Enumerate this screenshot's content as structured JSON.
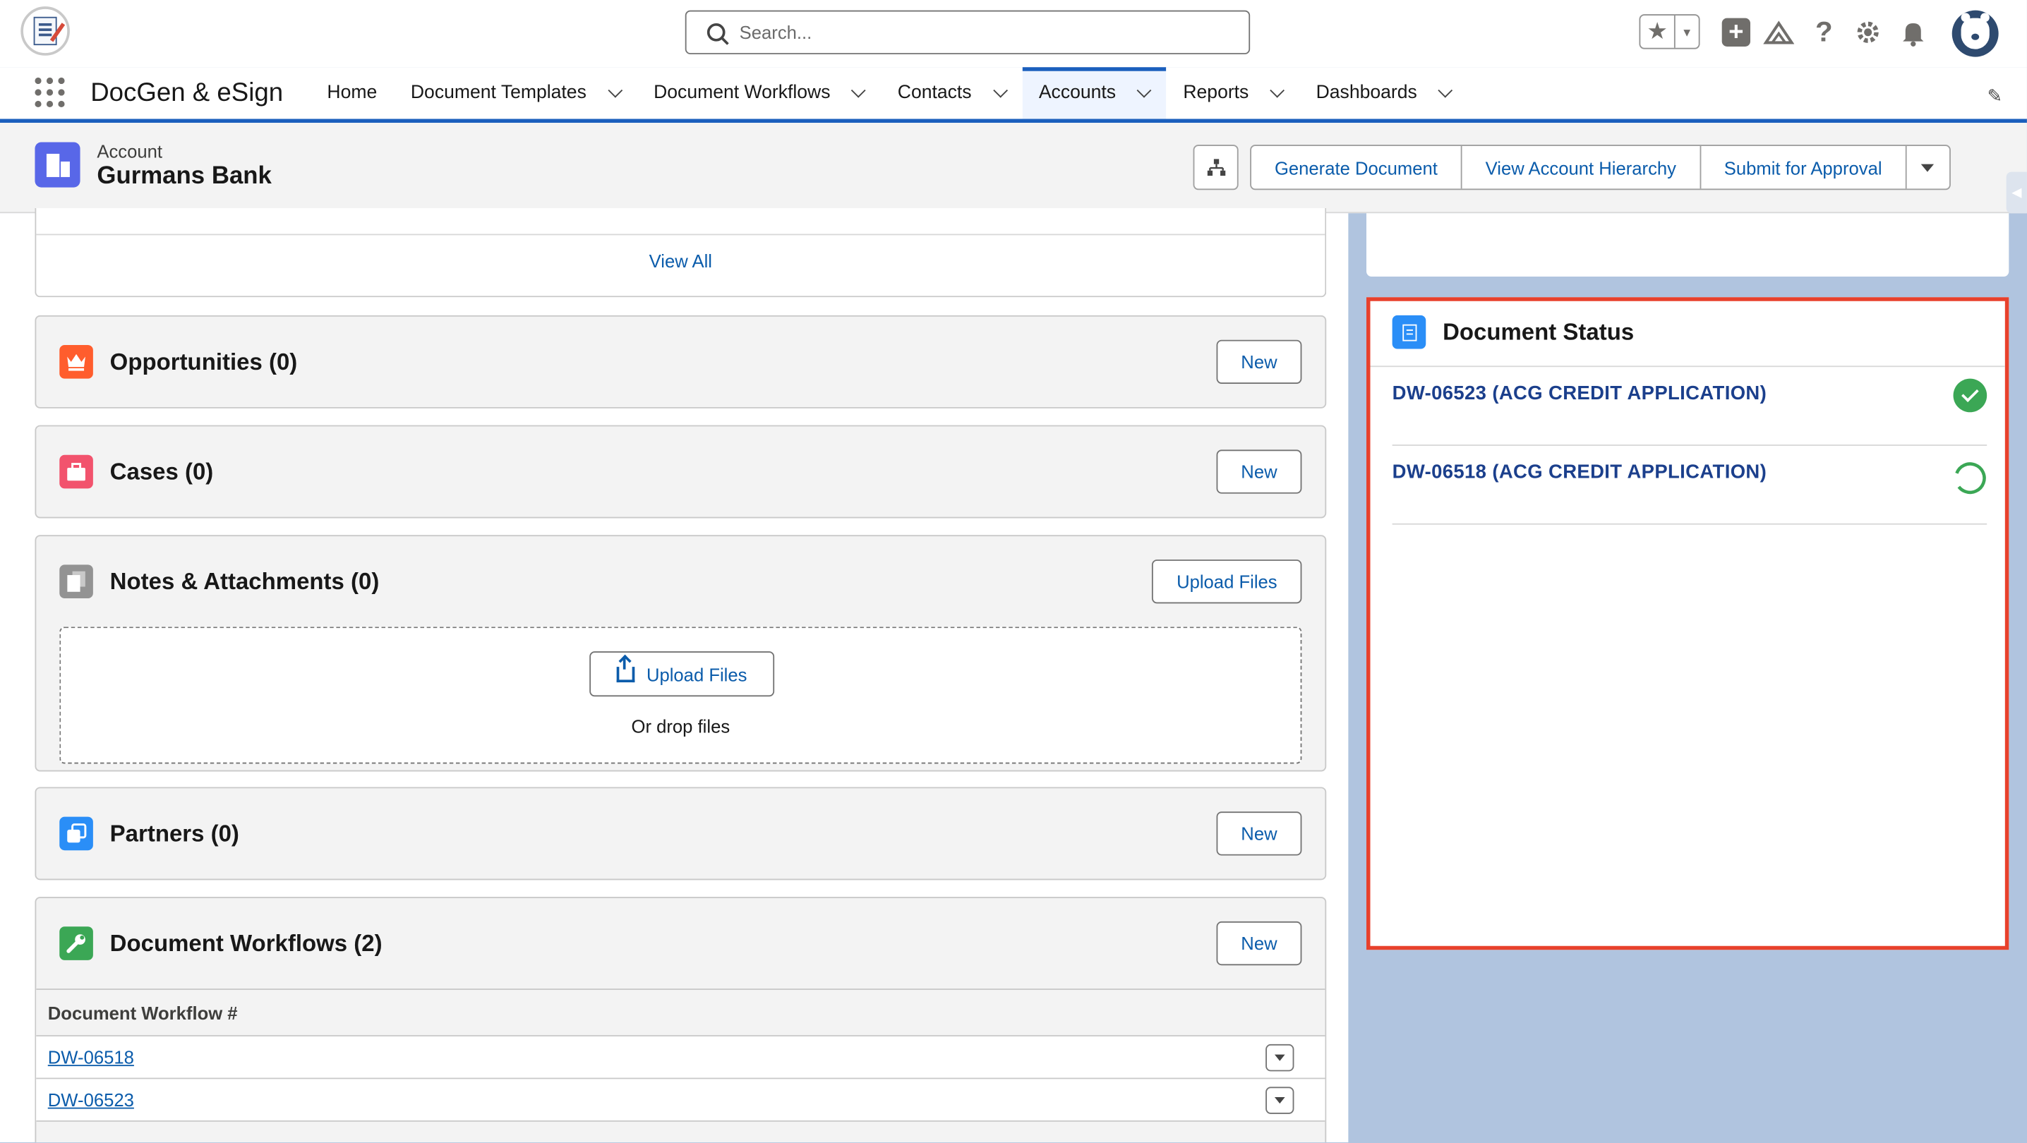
{
  "header": {
    "search_placeholder": "Search..."
  },
  "nav": {
    "app_name": "DocGen & eSign",
    "items": [
      {
        "label": "Home",
        "has_menu": false
      },
      {
        "label": "Document Templates",
        "has_menu": true
      },
      {
        "label": "Document Workflows",
        "has_menu": true
      },
      {
        "label": "Contacts",
        "has_menu": true
      },
      {
        "label": "Accounts",
        "has_menu": true,
        "active": true
      },
      {
        "label": "Reports",
        "has_menu": true
      },
      {
        "label": "Dashboards",
        "has_menu": true
      }
    ]
  },
  "record": {
    "type": "Account",
    "name": "Gurmans Bank",
    "actions": [
      "Generate Document",
      "View Account Hierarchy",
      "Submit for Approval"
    ]
  },
  "related": {
    "view_all": "View All",
    "opportunities": {
      "title": "Opportunities (0)",
      "button": "New"
    },
    "cases": {
      "title": "Cases (0)",
      "button": "New"
    },
    "notes": {
      "title": "Notes & Attachments (0)",
      "button": "Upload Files",
      "upload_label": "Upload Files",
      "drop_text": "Or drop files"
    },
    "partners": {
      "title": "Partners (0)",
      "button": "New"
    },
    "workflows": {
      "title": "Document Workflows (2)",
      "button": "New",
      "column": "Document Workflow #",
      "rows": [
        "DW-06518",
        "DW-06523"
      ]
    }
  },
  "document_status": {
    "title": "Document Status",
    "items": [
      {
        "label": "DW-06523 (ACG CREDIT APPLICATION)",
        "status": "complete"
      },
      {
        "label": "DW-06518 (ACG CREDIT APPLICATION)",
        "status": "in-progress"
      }
    ]
  },
  "colors": {
    "brand_blue": "#0b5cab",
    "nav_active": "#1b5fbd",
    "highlight_border": "#e8412c",
    "status_complete": "#3ba755"
  }
}
